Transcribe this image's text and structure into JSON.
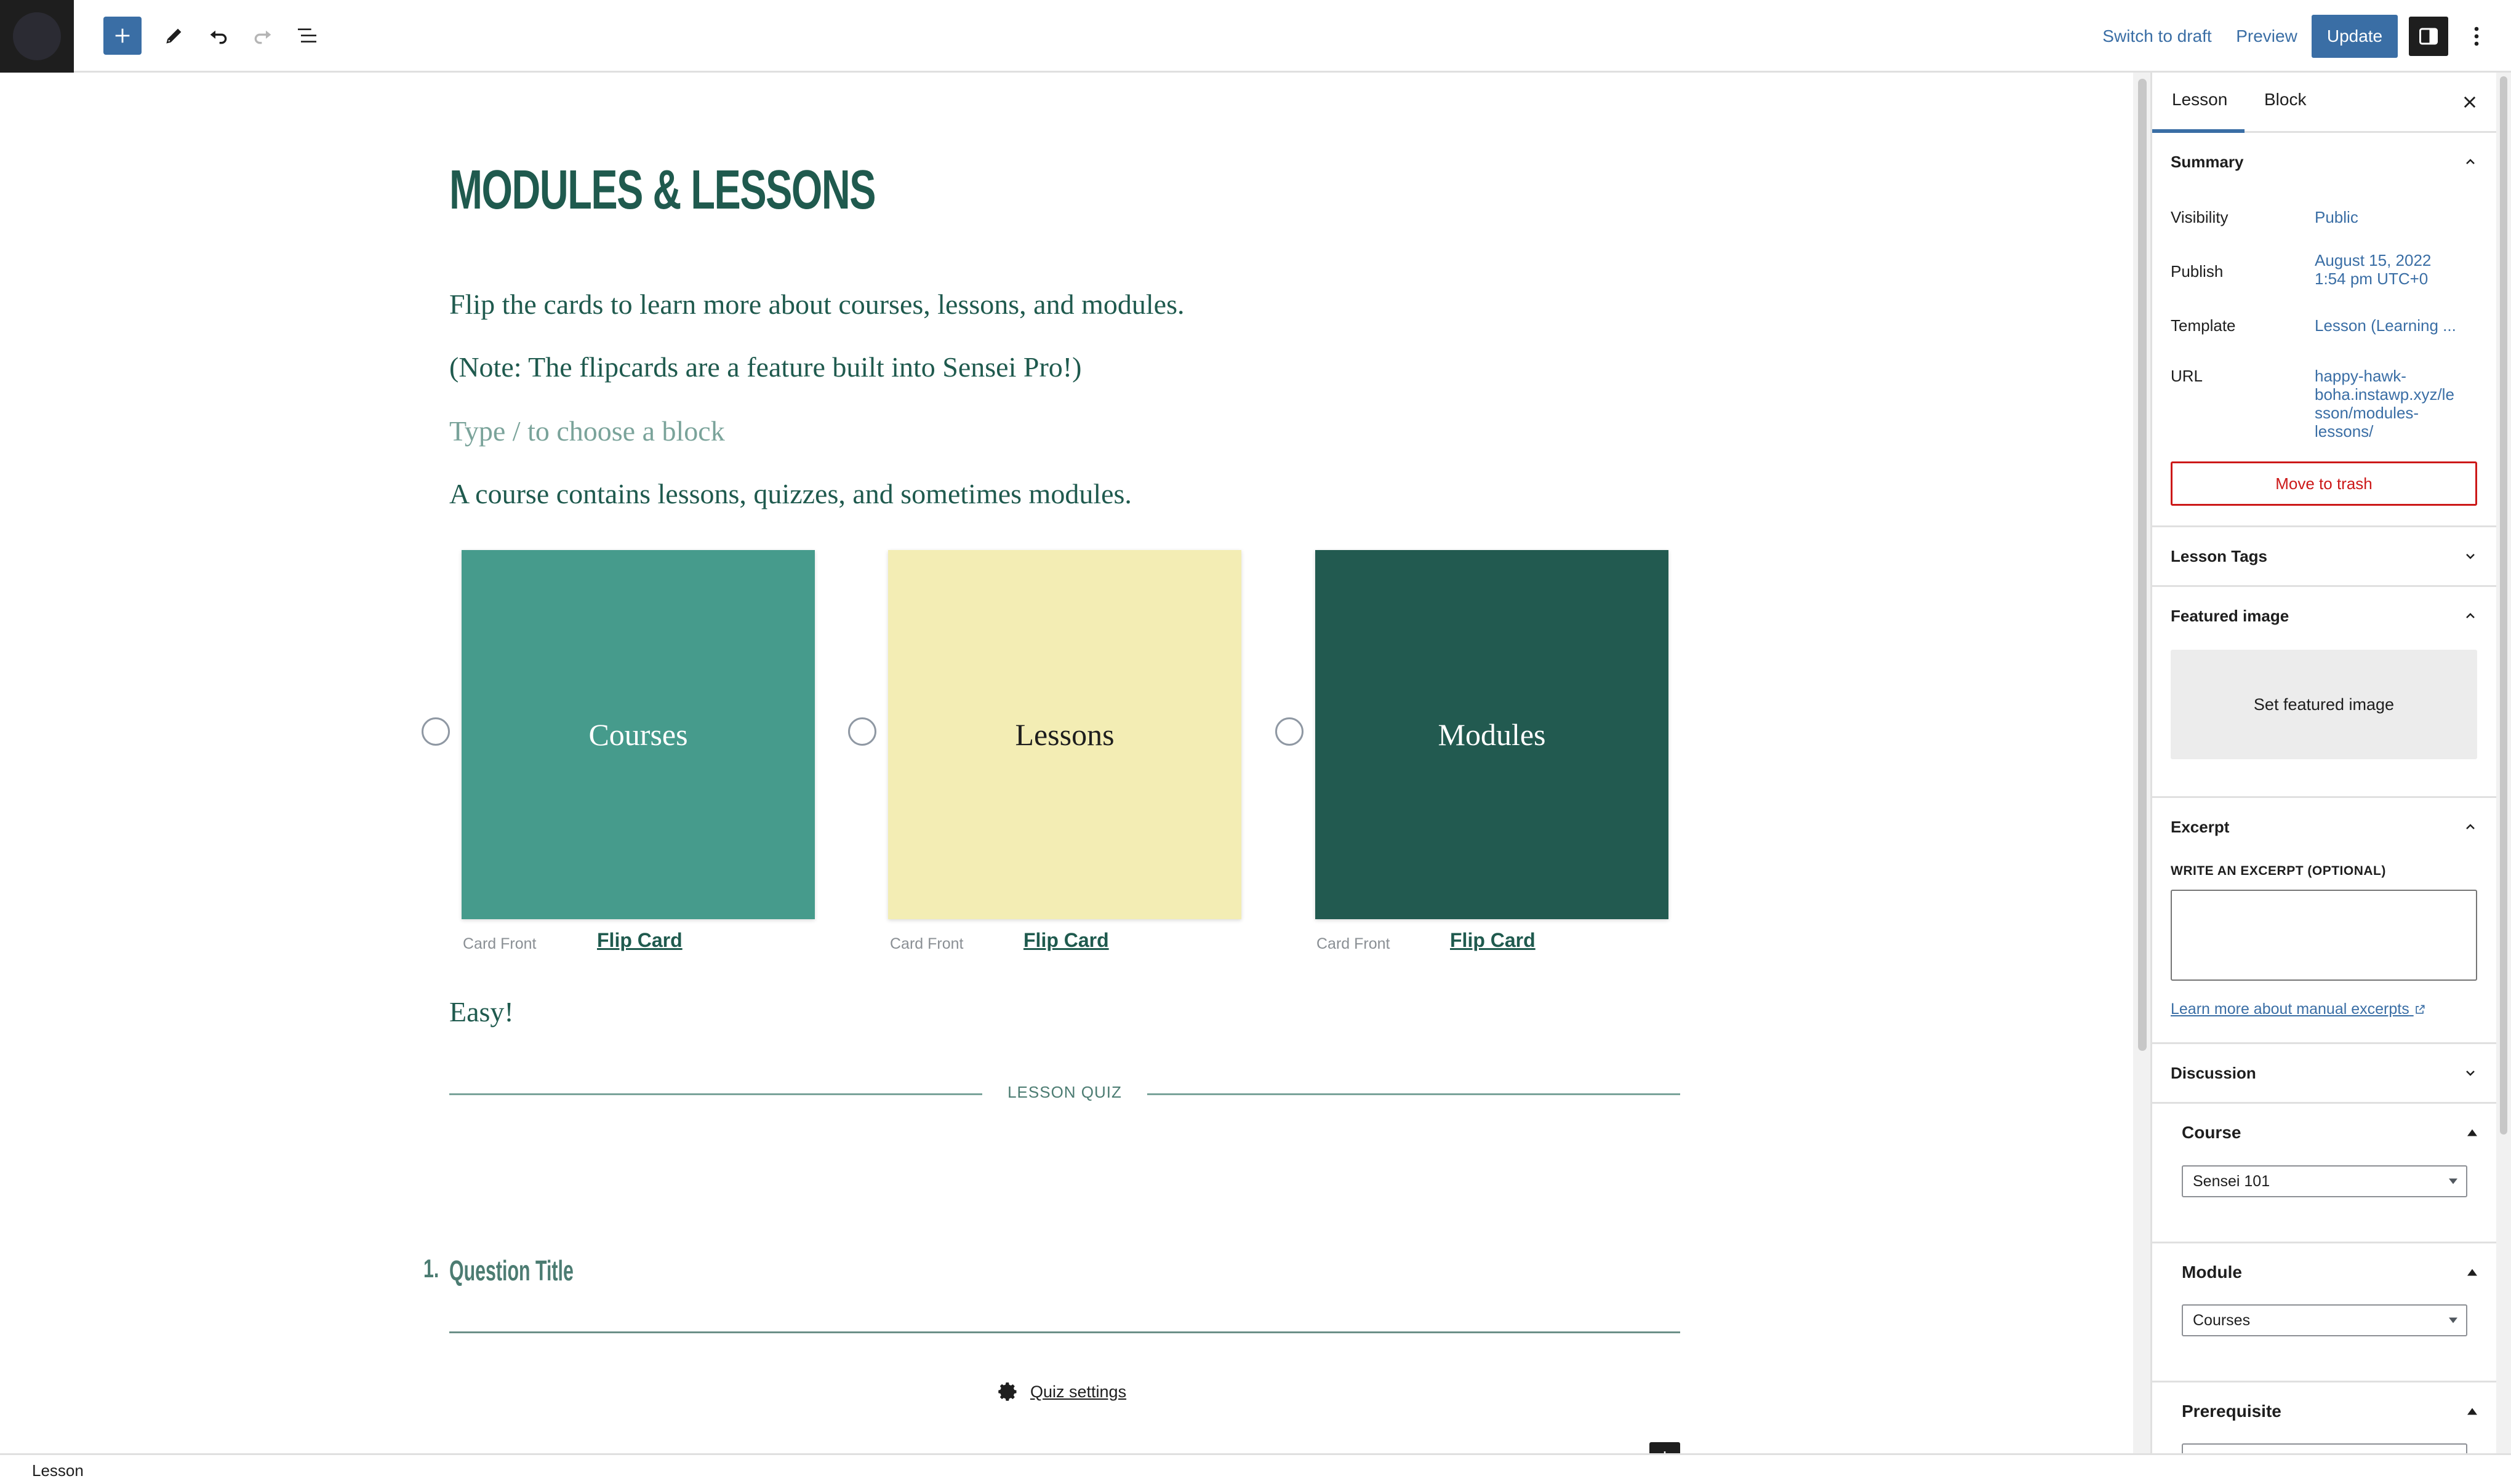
{
  "toolbar": {
    "switch_to_draft": "Switch to draft",
    "preview": "Preview",
    "update": "Update",
    "icons": [
      "inserter-plus",
      "pencil",
      "undo",
      "redo",
      "list-view",
      "settings-panel",
      "more-vertical"
    ]
  },
  "editor": {
    "title": "MODULES & LESSONS",
    "paragraphs": [
      "Flip the cards to learn more about courses, lessons, and modules.",
      "(Note: The flipcards are a feature built into Sensei Pro!)"
    ],
    "block_placeholder": "Type / to choose a block",
    "course_intro": "A course contains lessons, quizzes, and sometimes modules.",
    "flip_cards": [
      {
        "label": "Courses",
        "card_front": "Card Front",
        "flip_card": "Flip Card",
        "color": "#469b8c",
        "text_color": "#ffffff"
      },
      {
        "label": "Lessons",
        "card_front": "Card Front",
        "flip_card": "Flip Card",
        "color": "#f3edb4",
        "text_color": "#1e1e1e"
      },
      {
        "label": "Modules",
        "card_front": "Card Front",
        "flip_card": "Flip Card",
        "color": "#225a50",
        "text_color": "#ffffff"
      }
    ],
    "closing": "Easy!",
    "quiz": {
      "label": "LESSON QUIZ",
      "question_number": "1.",
      "question_title": "Question Title",
      "settings_link": "Quiz settings"
    }
  },
  "sidebar": {
    "tabs": [
      "Lesson",
      "Block"
    ],
    "active_tab": "Lesson",
    "summary": {
      "heading": "Summary",
      "rows": [
        {
          "label": "Visibility",
          "value": "Public"
        },
        {
          "label": "Publish",
          "value_line1": "August 15, 2022",
          "value_line2": "1:54 pm UTC+0"
        },
        {
          "label": "Template",
          "value": "Lesson (Learning ..."
        },
        {
          "label": "URL",
          "value_lines": [
            "happy-hawk-",
            "boha.instawp.xyz/le",
            "sson/modules-",
            "lessons/"
          ]
        }
      ],
      "trash": "Move to trash"
    },
    "lesson_tags": "Lesson Tags",
    "featured_image": {
      "heading": "Featured image",
      "button": "Set featured image"
    },
    "excerpt": {
      "heading": "Excerpt",
      "label": "WRITE AN EXCERPT (OPTIONAL)",
      "value": "",
      "link": "Learn more about manual excerpts"
    },
    "discussion": "Discussion",
    "course": {
      "heading": "Course",
      "selected": "Sensei 101"
    },
    "module": {
      "heading": "Module",
      "selected": "Courses"
    },
    "prerequisite": {
      "heading": "Prerequisite"
    }
  },
  "footer": {
    "breadcrumb": "Lesson"
  },
  "colors": {
    "accent": "#3a6ea5",
    "theme_text": "#1f5a4e",
    "danger": "#cc1818"
  }
}
